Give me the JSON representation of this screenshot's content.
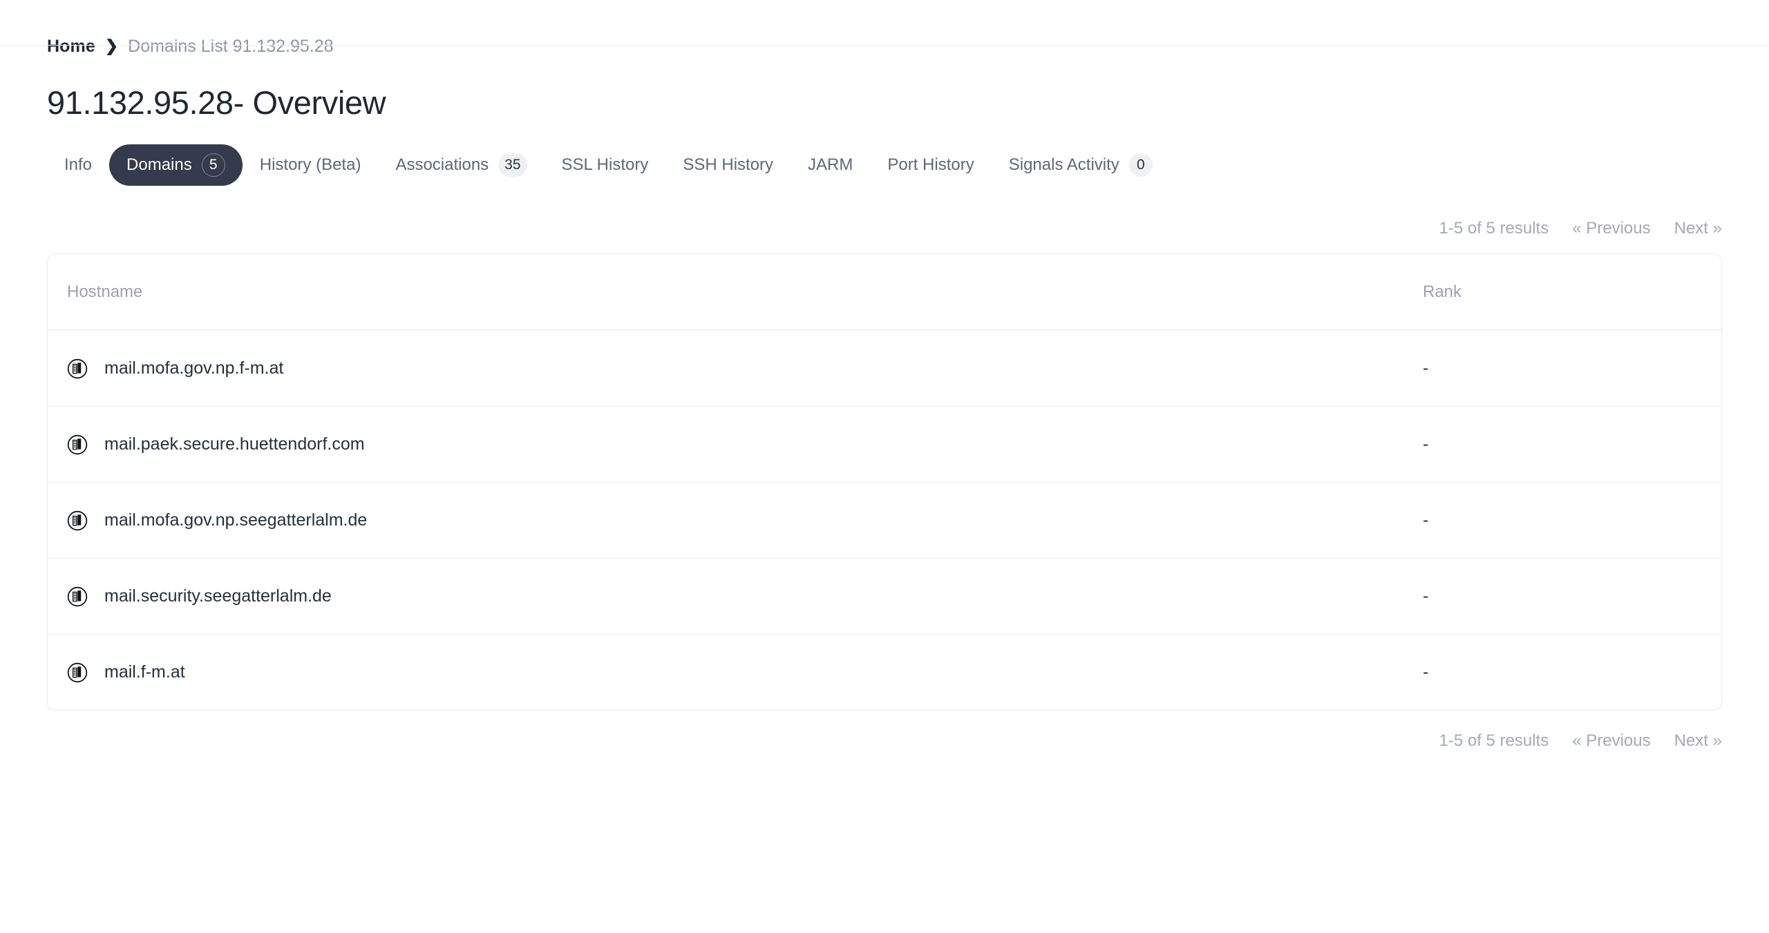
{
  "breadcrumb": {
    "home_label": "Home",
    "separator": "❯",
    "current_label": "Domains List 91.132.95.28"
  },
  "page_title": "91.132.95.28- Overview",
  "tabs": [
    {
      "label": "Info",
      "badge": null,
      "active": false
    },
    {
      "label": "Domains",
      "badge": "5",
      "active": true
    },
    {
      "label": "History (Beta)",
      "badge": null,
      "active": false
    },
    {
      "label": "Associations",
      "badge": "35",
      "active": false
    },
    {
      "label": "SSL History",
      "badge": null,
      "active": false
    },
    {
      "label": "SSH History",
      "badge": null,
      "active": false
    },
    {
      "label": "JARM",
      "badge": null,
      "active": false
    },
    {
      "label": "Port History",
      "badge": null,
      "active": false
    },
    {
      "label": "Signals Activity",
      "badge": "0",
      "active": false
    }
  ],
  "pagination": {
    "results_label": "1-5 of 5 results",
    "previous_label": "« Previous",
    "next_label": "Next »"
  },
  "table": {
    "columns": [
      "Hostname",
      "Rank"
    ],
    "row_icon": "domain-building-icon",
    "rows": [
      {
        "hostname": "mail.mofa.gov.np.f-m.at",
        "rank": "-"
      },
      {
        "hostname": "mail.paek.secure.huettendorf.com",
        "rank": "-"
      },
      {
        "hostname": "mail.mofa.gov.np.seegatterlalm.de",
        "rank": "-"
      },
      {
        "hostname": "mail.security.seegatterlalm.de",
        "rank": "-"
      },
      {
        "hostname": "mail.f-m.at",
        "rank": "-"
      }
    ]
  },
  "colors": {
    "active_tab_bg": "#343b4c",
    "badge_bg": "#eff0f3",
    "muted_text": "#9ba1b0",
    "body_text": "#24303d",
    "border": "#e9eaee"
  }
}
